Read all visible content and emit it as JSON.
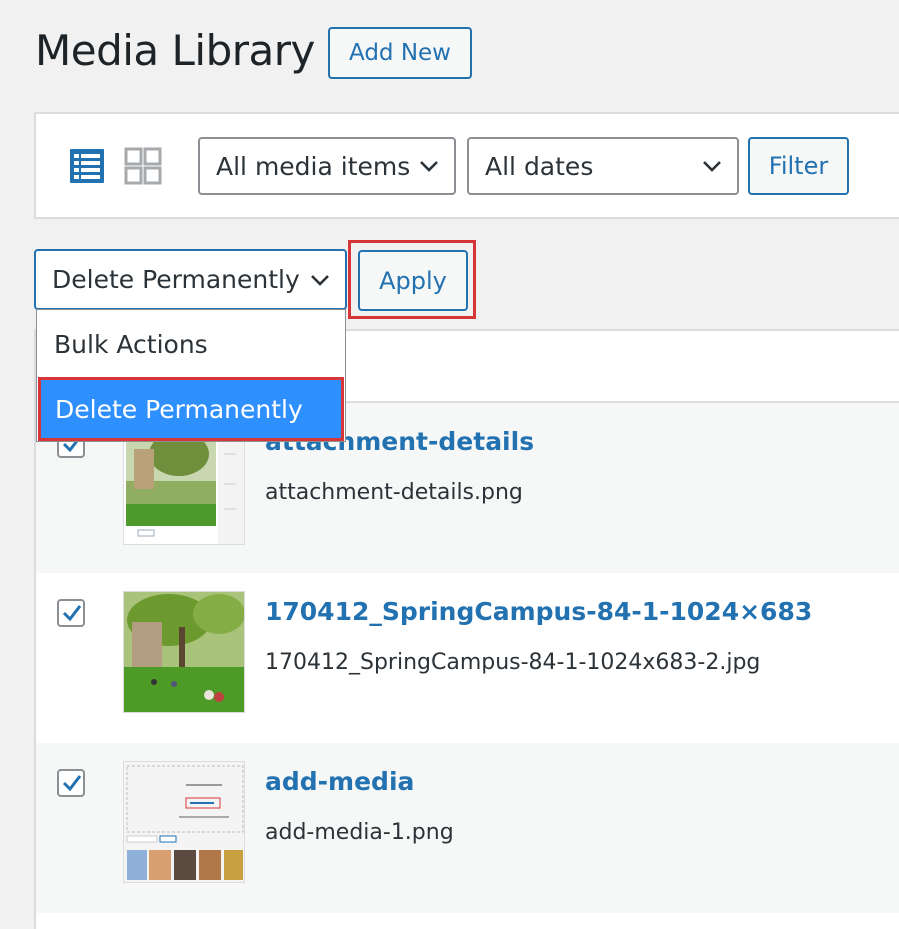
{
  "page": {
    "title": "Media Library",
    "add_new_label": "Add New"
  },
  "filters": {
    "type_value": "All media items",
    "date_value": "All dates",
    "filter_label": "Filter"
  },
  "bulk": {
    "selected_value": "Delete Permanently",
    "apply_label": "Apply",
    "options": [
      "Bulk Actions",
      "Delete Permanently"
    ],
    "highlighted_option": "Delete Permanently"
  },
  "rows": [
    {
      "title": "attachment-details",
      "filename": "attachment-details.png",
      "checked": true
    },
    {
      "title": "170412_SpringCampus-84-1-1024×683",
      "filename": "170412_SpringCampus-84-1-1024x683-2.jpg",
      "checked": true
    },
    {
      "title": "add-media",
      "filename": "add-media-1.png",
      "checked": true
    }
  ],
  "icons": {
    "list_view": "list-view-icon",
    "grid_view": "grid-view-icon",
    "chevron": "chevron-down-icon",
    "check": "checkmark-icon"
  },
  "colors": {
    "accent": "#2271b1",
    "highlight": "#2e8fff",
    "annotation_red": "#d63638"
  }
}
